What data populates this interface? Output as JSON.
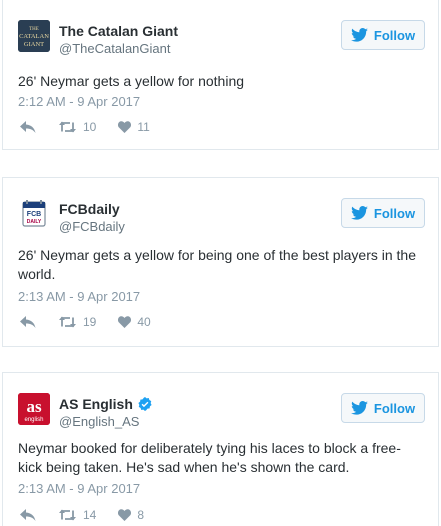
{
  "colors": {
    "link_blue": "#1b95e0",
    "muted_gray": "#8899a6",
    "handle_gray": "#66757f",
    "text": "#292f33",
    "border": "#e1e8ed",
    "as_red": "#c8102e",
    "catalan_navy": "#2a3e53",
    "verified_blue": "#1da1f2"
  },
  "tweets": [
    {
      "display_name": "The Catalan Giant",
      "handle": "@TheCatalanGiant",
      "avatar_text_top": "THE",
      "avatar_text_mid": "CATALAN",
      "avatar_text_bottom": "GIANT",
      "verified": false,
      "follow_label": "Follow",
      "text": "26' Neymar gets a yellow for nothing",
      "timestamp": "2:12 AM - 9 Apr 2017",
      "retweets": "10",
      "likes": "11"
    },
    {
      "display_name": "FCBdaily",
      "handle": "@FCBdaily",
      "avatar_text_top": "FCB",
      "avatar_text_bottom": "DAILY",
      "verified": false,
      "follow_label": "Follow",
      "text": "26' Neymar gets a yellow for being one of the best players in the world.",
      "timestamp": "2:13 AM - 9 Apr 2017",
      "retweets": "19",
      "likes": "40"
    },
    {
      "display_name": "AS English",
      "handle": "@English_AS",
      "avatar_text_top": "as",
      "avatar_text_bottom": "english",
      "verified": true,
      "follow_label": "Follow",
      "text": "Neymar booked for deliberately tying his laces to block a free-kick being taken. He's sad when he's shown the card.",
      "timestamp": "2:13 AM - 9 Apr 2017",
      "retweets": "14",
      "likes": "8"
    }
  ]
}
